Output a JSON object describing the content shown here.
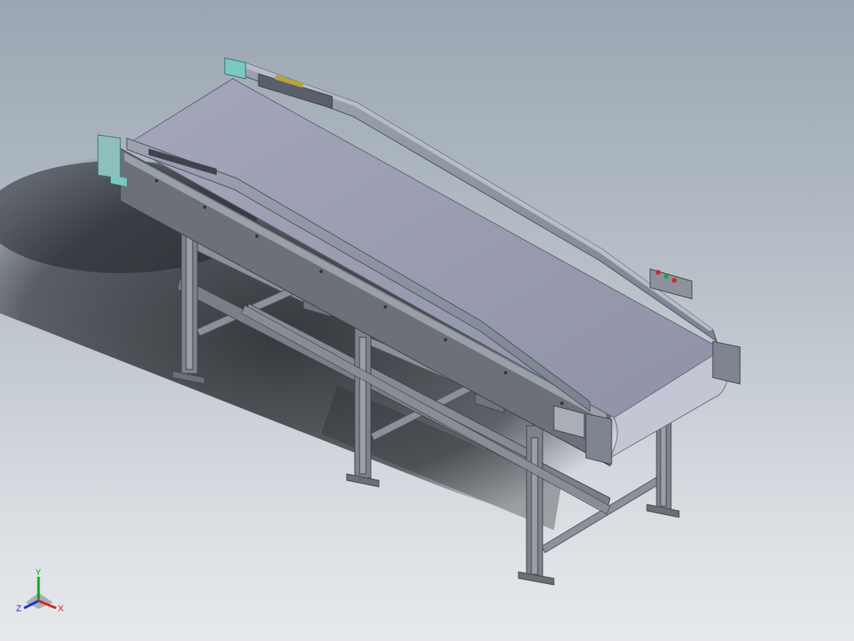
{
  "viewport": {
    "background_top": "#9aa6b2",
    "background_bottom": "#e7e9ec",
    "model": "belt-conveyor",
    "colors": {
      "frame": "#7c8189",
      "frame_dark": "#4d525a",
      "belt": "#9c9fb3",
      "belt_light": "#b9bccb",
      "guard": "#8d93a3",
      "end_cap": "#79c9c4",
      "leg": "#7e838b",
      "shadow": "#2b2e33"
    }
  },
  "triad": {
    "x_label": "X",
    "y_label": "Y",
    "z_label": "Z",
    "x_color": "#d62020",
    "y_color": "#1a9a1a",
    "z_color": "#2030c8"
  }
}
